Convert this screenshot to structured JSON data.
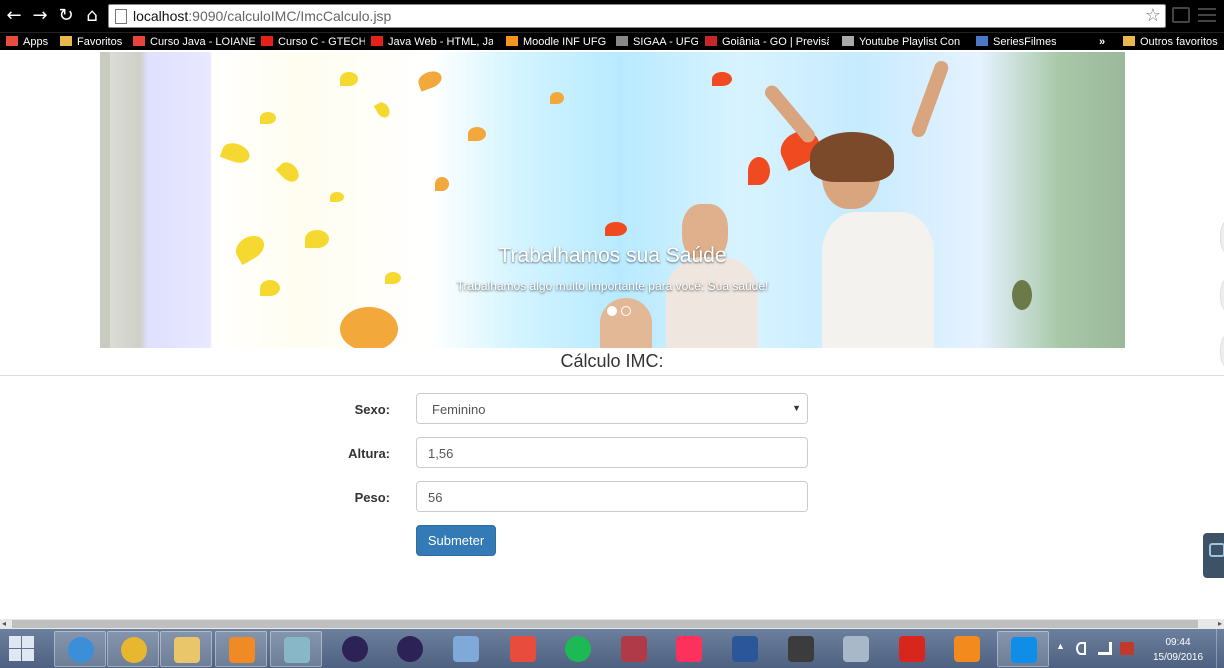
{
  "browser": {
    "url": "localhost:9090/calculoIMC/ImcCalculo.jsp",
    "url_host": "localhost",
    "url_rest": ":9090/calculoIMC/ImcCalculo.jsp",
    "bookmarks": [
      {
        "label": "Apps",
        "icon": "apps-grid-icon",
        "color": "#e84c3d"
      },
      {
        "label": "Favoritos",
        "icon": "folder-icon",
        "color": "#e8b84a"
      },
      {
        "label": "Curso Java - LOIANE",
        "icon": "code-icon",
        "color": "#e8443a"
      },
      {
        "label": "Curso C - GTECH",
        "icon": "youtube-icon",
        "color": "#e62117"
      },
      {
        "label": "Java Web - HTML, Ja",
        "icon": "youtube-icon",
        "color": "#e62117"
      },
      {
        "label": "Moodle INF UFG",
        "icon": "moodle-icon",
        "color": "#f7941d"
      },
      {
        "label": "SIGAA - UFG",
        "icon": "page-icon",
        "color": "#888888"
      },
      {
        "label": "Goiânia - GO | Previsã",
        "icon": "weather-icon",
        "color": "#c62828"
      },
      {
        "label": "Youtube Playlist Con",
        "icon": "music-icon",
        "color": "#aaaaaa"
      },
      {
        "label": "SeriesFilmes",
        "icon": "globe-icon",
        "color": "#4a79c8"
      }
    ],
    "bookmarks_overflow": "»",
    "other_bookmarks": "Outros favoritos"
  },
  "carousel": {
    "title": "Trabalhamos sua Saúde",
    "text": "Trabalhamos algo muito importante para você: Sua saúde!",
    "slide_count": 2,
    "active_slide": 1
  },
  "page": {
    "title": "Cálculo IMC:"
  },
  "form": {
    "sex_label": "Sexo:",
    "sex_value": "Feminino",
    "height_label": "Altura:",
    "height_value": "1,56",
    "weight_label": "Peso:",
    "weight_value": "56",
    "submit_label": "Submeter"
  },
  "taskbar": {
    "apps": [
      {
        "name": "internet-explorer",
        "color": "#3a8fd8"
      },
      {
        "name": "chrome",
        "color": "#e8b730"
      },
      {
        "name": "file-explorer",
        "color": "#e9c66a"
      },
      {
        "name": "media-player",
        "color": "#f08a24"
      },
      {
        "name": "notepad",
        "color": "#88b8c8"
      },
      {
        "name": "eclipse",
        "color": "#2c2255"
      },
      {
        "name": "eclipse-2",
        "color": "#2c2255"
      },
      {
        "name": "virtualbox",
        "color": "#7fa9d8"
      },
      {
        "name": "office-tiles",
        "color": "#e84c3d"
      },
      {
        "name": "spotify",
        "color": "#1db954"
      },
      {
        "name": "anki",
        "color": "#b03a48"
      },
      {
        "name": "intellij",
        "color": "#fe315d"
      },
      {
        "name": "word",
        "color": "#2b579a"
      },
      {
        "name": "terminal",
        "color": "#3c3c3c"
      },
      {
        "name": "calculator",
        "color": "#a9b8c8"
      },
      {
        "name": "acrobat",
        "color": "#d9261c"
      },
      {
        "name": "pdf-tool",
        "color": "#f28a1e"
      },
      {
        "name": "teamviewer",
        "color": "#0e8ee9"
      }
    ],
    "time": "09:44",
    "date": "15/09/2016"
  }
}
